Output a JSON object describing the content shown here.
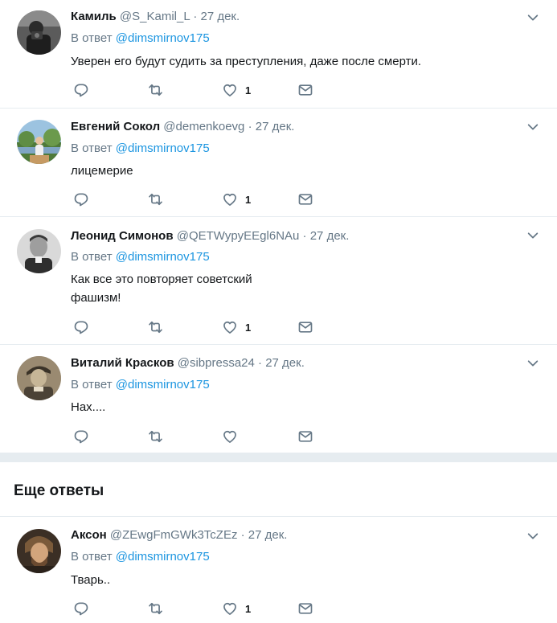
{
  "reply_prefix": "В ответ",
  "tweets": [
    {
      "name": "Камиль",
      "handle": "@S_Kamil_L",
      "dot": "·",
      "date": "27 дек.",
      "mention": "@dimsmirnov175",
      "text": "Уверен его будут судить за преступления, даже после смерти.",
      "likes": "1"
    },
    {
      "name": "Евгений Сокол",
      "handle": "@demenkoevg",
      "dot": "·",
      "date": "27 дек.",
      "mention": "@dimsmirnov175",
      "text": "лицемерие",
      "likes": "1"
    },
    {
      "name": "Леонид Симонов",
      "handle": "@QETWypyEEgl6NAu",
      "dot": "·",
      "date": "27 дек.",
      "mention": "@dimsmirnov175",
      "text_line1": "Как все это повторяет советский",
      "text_line2": "фашизм!",
      "likes": "1"
    },
    {
      "name": "Виталий Красков",
      "handle": "@sibpressa24",
      "dot": "·",
      "date": "27 дек.",
      "mention": "@dimsmirnov175",
      "text": "Нах....",
      "likes": ""
    },
    {
      "name": "Аксон",
      "handle": "@ZEwgFmGWk3TcZEz",
      "dot": "·",
      "date": "27 дек.",
      "mention": "@dimsmirnov175",
      "text": "Тварь..",
      "likes": "1"
    }
  ],
  "more_replies_title": "Еще ответы",
  "colors": {
    "icon": "#657786",
    "link": "#1b95e0",
    "border": "#e6ecf0"
  },
  "icons": [
    "reply-icon",
    "retweet-icon",
    "like-icon",
    "message-icon",
    "chevron-down-icon"
  ]
}
